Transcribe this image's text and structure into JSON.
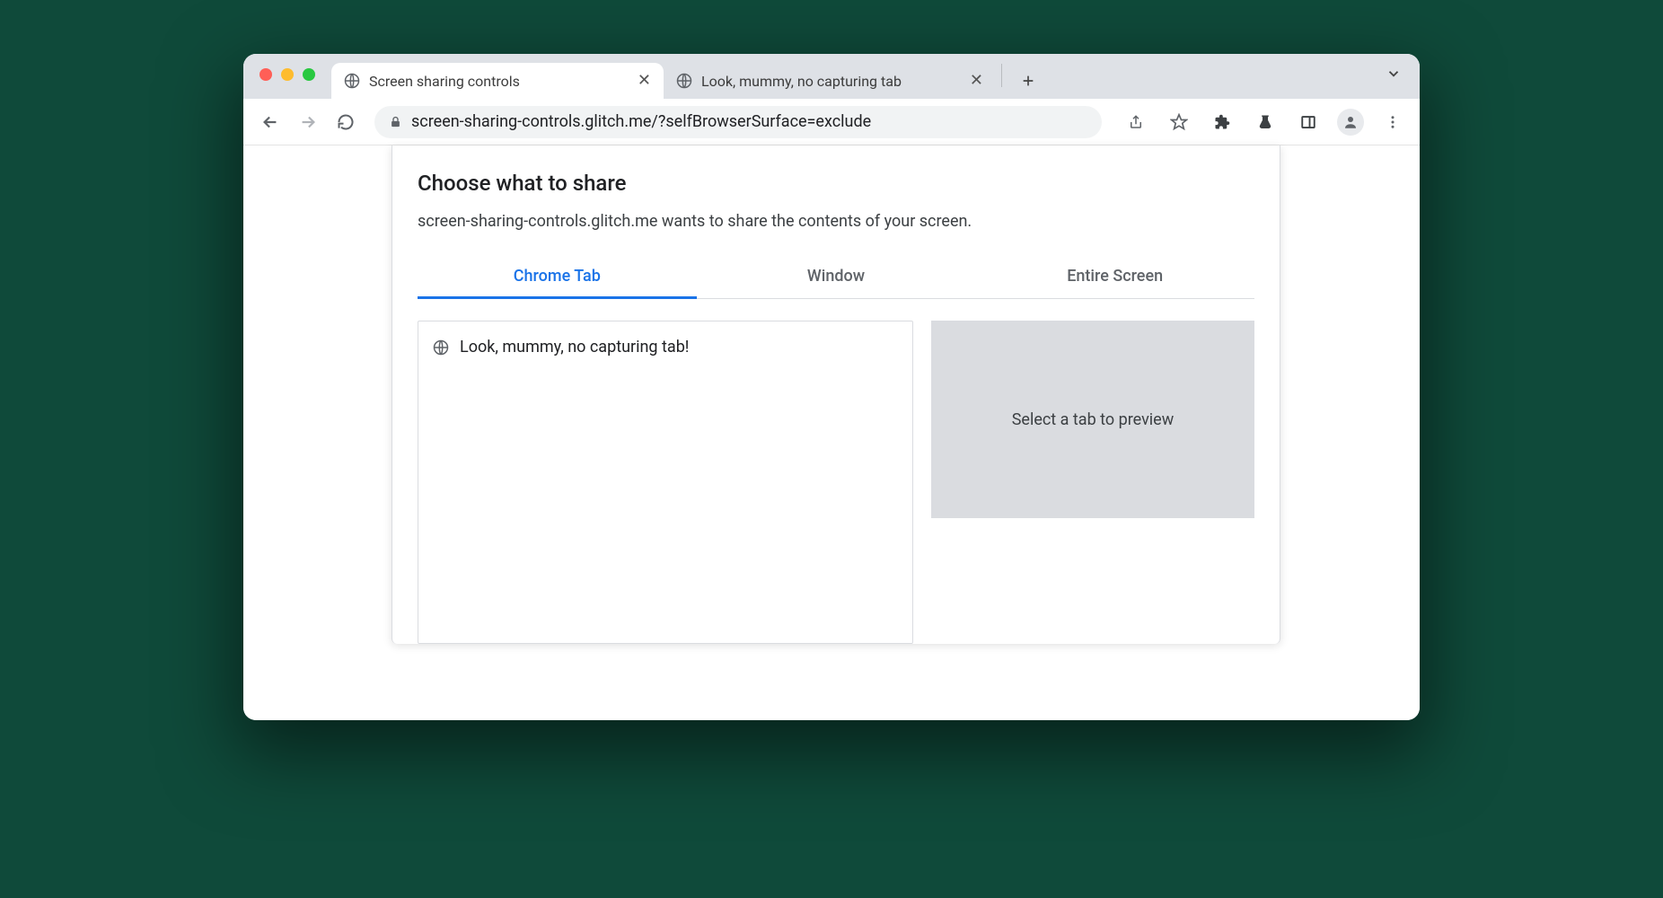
{
  "browser": {
    "tabs": [
      {
        "title": "Screen sharing controls",
        "active": true
      },
      {
        "title": "Look, mummy, no capturing tab",
        "active": false
      }
    ],
    "url": "screen-sharing-controls.glitch.me/?selfBrowserSurface=exclude"
  },
  "modal": {
    "title": "Choose what to share",
    "subtitle": "screen-sharing-controls.glitch.me wants to share the contents of your screen.",
    "tabs": {
      "chrome_tab": "Chrome Tab",
      "window": "Window",
      "entire_screen": "Entire Screen"
    },
    "list": [
      {
        "title": "Look, mummy, no capturing tab!"
      }
    ],
    "preview_placeholder": "Select a tab to preview"
  }
}
